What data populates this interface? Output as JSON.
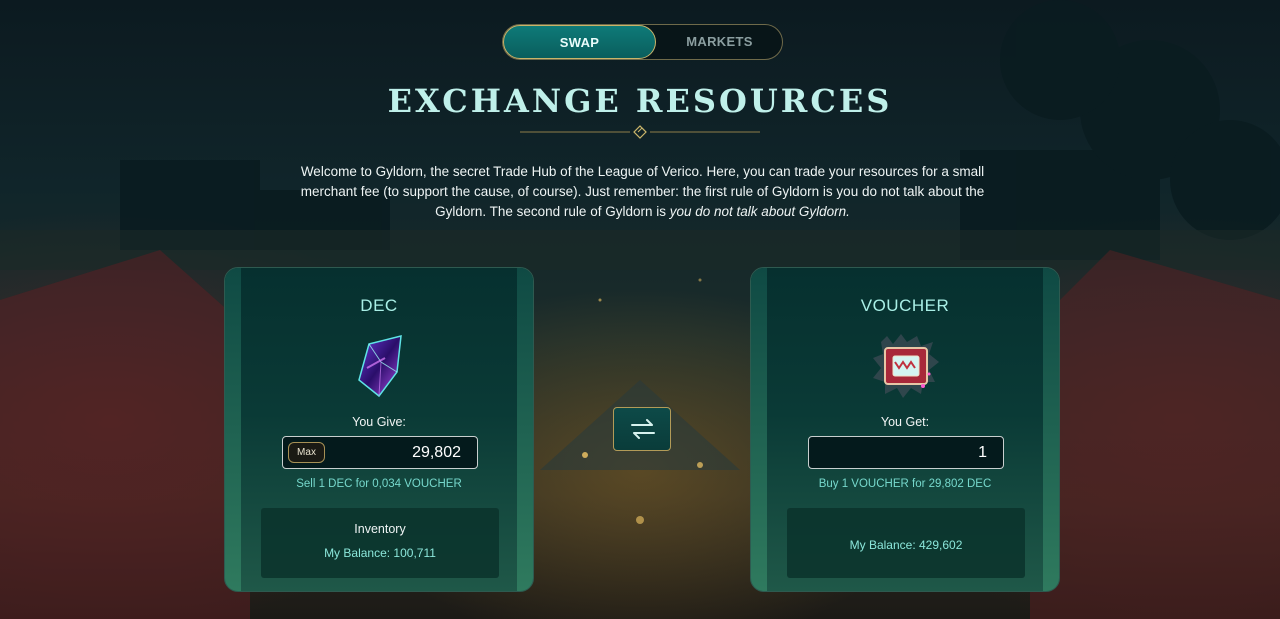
{
  "nav": {
    "tabs": [
      {
        "label": "SWAP",
        "active": true
      },
      {
        "label": "MARKETS",
        "active": false
      }
    ]
  },
  "page": {
    "title": "EXCHANGE RESOURCES",
    "intro_main": "Welcome to Gyldorn, the secret Trade Hub of the League of Verico. Here, you can trade your resources for a small merchant fee (to support the cause, of course). Just remember: the first rule of Gyldorn is you do not talk about the Gyldorn. The second rule of Gyldorn is",
    "intro_italic": "you do not talk about Gyldorn."
  },
  "give_card": {
    "resource": "DEC",
    "icon": "dec-crystal-icon",
    "field_label": "You Give:",
    "max_label": "Max",
    "amount": "29,802",
    "rate": "Sell 1 DEC for 0,034 VOUCHER",
    "info_title": "Inventory",
    "balance": "My Balance: 100,711"
  },
  "get_card": {
    "resource": "VOUCHER",
    "icon": "voucher-ticket-icon",
    "field_label": "You Get:",
    "amount": "1",
    "rate": "Buy 1 VOUCHER for 29,802 DEC",
    "balance": "My Balance: 429,602"
  },
  "swap_button": {
    "icon": "swap-arrows-icon"
  },
  "colors": {
    "accent_teal": "#0e7a78",
    "gold_border": "#c9b46a",
    "title_color": "#bff0ea",
    "rate_color": "#76d8cc"
  }
}
